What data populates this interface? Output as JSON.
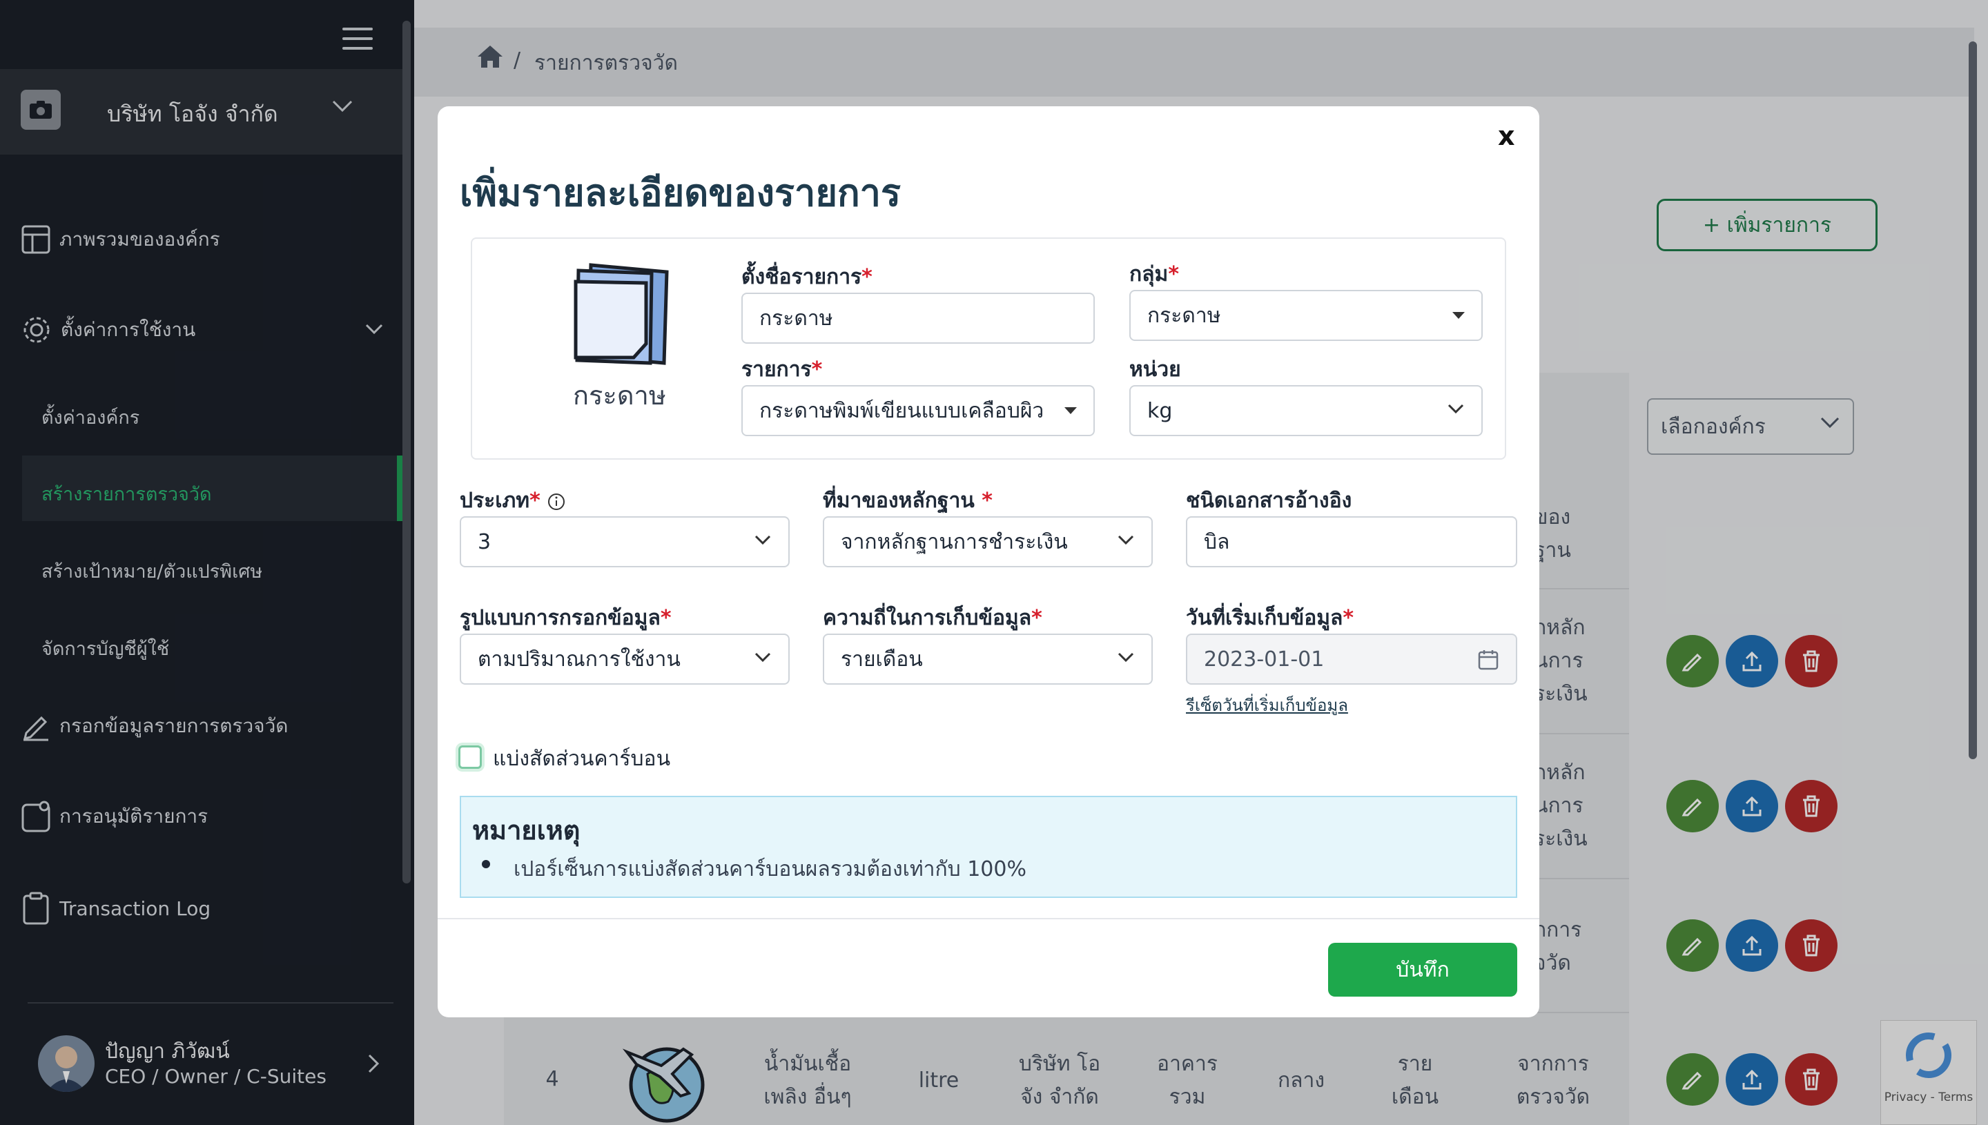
{
  "sidebar": {
    "company_name": "บริษัท โอจัง จำกัด",
    "nav": [
      {
        "label": "ภาพรวมขององค์กร",
        "icon": "layout-icon"
      },
      {
        "label": "ตั้งค่าการใช้งาน",
        "icon": "gear-icon"
      }
    ],
    "subnav": [
      {
        "label": "ตั้งค่าองค์กร"
      },
      {
        "label": "สร้างรายการตรวจวัด"
      },
      {
        "label": "สร้างเป้าหมาย/ตัวแปรพิเศษ"
      },
      {
        "label": "จัดการบัญชีผู้ใช้"
      }
    ],
    "nav2": [
      {
        "label": "กรอกข้อมูลรายการตรวจวัด",
        "icon": "pencil-icon"
      },
      {
        "label": "การอนุมัติรายการ",
        "icon": "approval-icon"
      },
      {
        "label": "Transaction Log",
        "icon": "clipboard-icon"
      }
    ],
    "user": {
      "name": "ปัญญา ภิวัฒน์",
      "role": "CEO / Owner / C-Suites"
    }
  },
  "breadcrumb": {
    "current": "รายการตรวจวัด"
  },
  "main": {
    "add_button": "+ เพิ่มรายการ",
    "org_select": "เลือกองค์กร",
    "partial_header": [
      "ของ",
      "ฐาน"
    ],
    "partial_rows": [
      [
        "กหลัก",
        "นการ",
        "ระเงิน"
      ],
      [
        "กหลัก",
        "นการ",
        "ระเงิน"
      ],
      [
        "กการ",
        "จวัด"
      ]
    ],
    "last_row": {
      "index": "4",
      "name": [
        "น้ำมันเชื้อ",
        "เพลิง อื่นๆ"
      ],
      "unit": "litre",
      "company": [
        "บริษัท โอ",
        "จัง จำกัด"
      ],
      "building": [
        "อาคาร",
        "รวม"
      ],
      "level": "กลาง",
      "freq": [
        "ราย",
        "เดือน"
      ],
      "source": [
        "จากการ",
        "ตรวจวัด"
      ]
    },
    "recaptcha": "Privacy - Terms"
  },
  "modal": {
    "close": "x",
    "title": "เพิ่มรายละเอียดของรายการ",
    "paper_label": "กระดาษ",
    "name_label": "ตั้งชื่อรายการ",
    "name_value": "กระดาษ",
    "group_label": "กลุ่ม",
    "group_value": "กระดาษ",
    "item_label": "รายการ",
    "item_value": "กระดาษพิมพ์เขียนแบบเคลือบผิว",
    "unit_label": "หน่วย",
    "unit_value": "kg",
    "type_label": "ประเภท",
    "type_value": "3",
    "evidence_label": "ที่มาของหลักฐาน",
    "evidence_value": "จากหลักฐานการชำระเงิน",
    "doctype_label": "ชนิดเอกสารอ้างอิง",
    "doctype_value": "บิล",
    "input_label": "รูปแบบการกรอกข้อมูล",
    "input_value": "ตามปริมาณการใช้งาน",
    "freq_label": "ความถี่ในการเก็บข้อมูล",
    "freq_value": "รายเดือน",
    "start_label": "วันที่เริ่มเก็บข้อมูล",
    "start_value": "2023-01-01",
    "reset_link": "รีเซ็ตวันที่เริ่มเก็บข้อมูล",
    "checkbox_label": "แบ่งสัดส่วนคาร์บอน",
    "note_title": "หมายเหตุ",
    "note_text": "เปอร์เซ็นการแบ่งสัดส่วนคาร์บอนผลรวมต้องเท่ากับ 100%",
    "save": "บันทึก"
  }
}
